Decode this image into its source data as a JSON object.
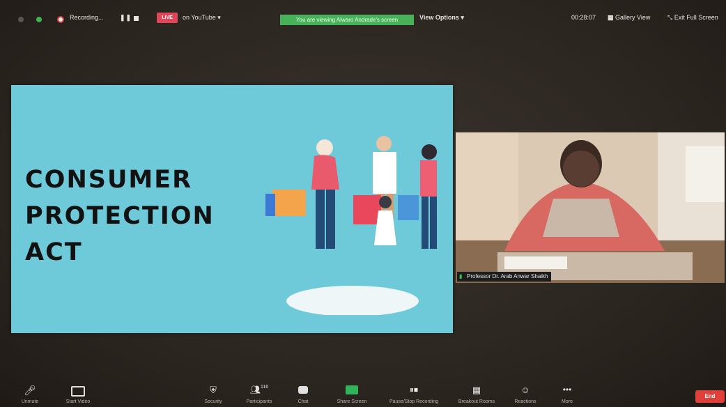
{
  "topbar": {
    "recording_label": "Recording...",
    "live_label": "LIVE",
    "stream_label": "on YouTube",
    "viewing_banner": "You are viewing Alwaro Andrade's screen",
    "view_options_label": "View Options",
    "timer": "00:28:07",
    "gallery_view_label": "Gallery View",
    "exit_full_screen_label": "Exit Full Screen"
  },
  "slide": {
    "title_lines": [
      "CONSUMER",
      "PROTECTION",
      "ACT"
    ]
  },
  "video": {
    "participant_name": "Professor Dr. Arab Anwar Shaikh"
  },
  "toolbar": {
    "unmute": "Unmute",
    "start_video": "Start Video",
    "security": "Security",
    "participants": "Participants",
    "participants_count": "116",
    "chat": "Chat",
    "share_screen": "Share Screen",
    "pause_stop_recording": "Pause/Stop Recording",
    "breakout_rooms": "Breakout Rooms",
    "reactions": "Reactions",
    "more": "More",
    "end": "End"
  },
  "colors": {
    "live": "#e0465a",
    "viewing_banner": "#47b25a",
    "end_button": "#e0403a",
    "slide_bg": "#6ec9d9"
  }
}
